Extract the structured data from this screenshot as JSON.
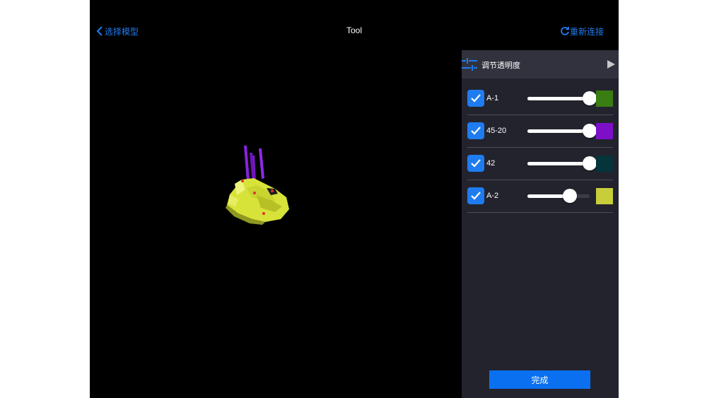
{
  "nav": {
    "back_label": "选择模型",
    "title": "Tool",
    "reconnect_label": "重新连接",
    "accent": "#1f7cf0"
  },
  "panel": {
    "title": "调节透明度",
    "done_label": "完成",
    "layers": [
      {
        "name": "A-1",
        "visible": true,
        "opacity": 1.0,
        "color": "#3a7d12"
      },
      {
        "name": "45-20",
        "visible": true,
        "opacity": 1.0,
        "color": "#7d0fc9"
      },
      {
        "name": "42",
        "visible": true,
        "opacity": 1.0,
        "color": "#05343a"
      },
      {
        "name": "A-2",
        "visible": true,
        "opacity": 0.68,
        "color": "#c7ce3a"
      }
    ]
  },
  "icons": {
    "back": "chevron-left-icon",
    "reconnect": "refresh-icon",
    "panel": "sliders-icon",
    "collapse": "play-triangle-icon",
    "check": "checkmark-icon"
  }
}
